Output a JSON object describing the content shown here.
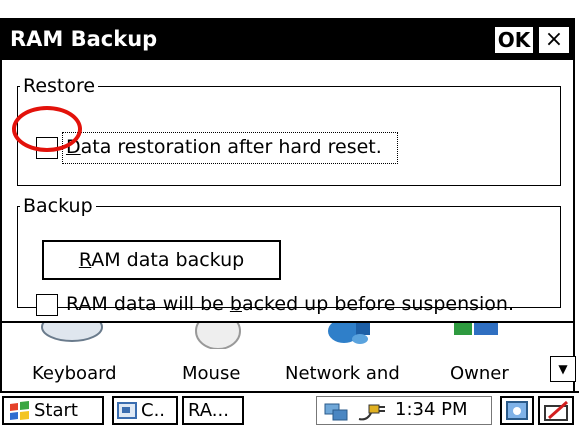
{
  "dialog": {
    "title": "RAM Backup",
    "ok_label": "OK",
    "close_label": "×",
    "restore": {
      "legend": "Restore",
      "checkbox_prefix": "",
      "checkbox_mnemonic": "D",
      "checkbox_rest": "ata restoration after hard reset.",
      "checked": false
    },
    "backup": {
      "legend": "Backup",
      "button_mnemonic": "R",
      "button_rest": "AM data backup",
      "checkbox_prefix": "RAM data will be ",
      "checkbox_mnemonic": "b",
      "checkbox_rest": "acked up before suspension.",
      "checked": false
    }
  },
  "annotation": {
    "color": "#e3120b"
  },
  "control_panel": {
    "items": [
      {
        "label": "Keyboard",
        "icon": "keyboard-icon"
      },
      {
        "label": "Mouse",
        "icon": "mouse-icon"
      },
      {
        "label": "Network and",
        "icon": "network-icon"
      },
      {
        "label": "Owner",
        "icon": "owner-icon"
      }
    ],
    "scroll_glyph": "▼"
  },
  "taskbar": {
    "start_label": "Start",
    "tasks": [
      {
        "label": "C..",
        "icon": "control-panel-icon"
      },
      {
        "label": "RA...",
        "icon": ""
      }
    ],
    "clock": "1:34 PM",
    "tray_icons": [
      "network-connection-icon",
      "power-icon",
      "desktop-icon",
      "stylus-icon"
    ]
  }
}
